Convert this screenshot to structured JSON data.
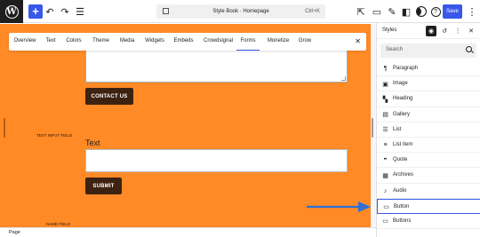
{
  "topbar": {
    "document_title": "Style Book · Homepage",
    "shortcut": "Ctrl+K",
    "save_label": "Save",
    "add_glyph": "+"
  },
  "tabs": [
    "Overview",
    "Text",
    "Colors",
    "Theme",
    "Media",
    "Widgets",
    "Embeds",
    "Crowdsignal",
    "Forms",
    "Monetize",
    "Grow"
  ],
  "active_tab": "Forms",
  "canvas": {
    "background": "#ff8a26",
    "contact_button": "CONTACT US",
    "text_input_side_label": "TEXT INPUT FIELD",
    "text_input_label": "Text",
    "submit_button": "SUBMIT",
    "name_side_label": "NAME FIELD"
  },
  "statusbar": {
    "breadcrumb": "Page"
  },
  "sidebar": {
    "title": "Styles",
    "search_placeholder": "Search",
    "blocks": [
      {
        "label": "Paragraph",
        "icon": "paragraph-icon",
        "glyph": "¶"
      },
      {
        "label": "Image",
        "icon": "image-icon",
        "glyph": "▣"
      },
      {
        "label": "Heading",
        "icon": "heading-icon",
        "glyph": "▚"
      },
      {
        "label": "Gallery",
        "icon": "gallery-icon",
        "glyph": "▤"
      },
      {
        "label": "List",
        "icon": "list-icon",
        "glyph": "☰"
      },
      {
        "label": "List item",
        "icon": "list-item-icon",
        "glyph": "≡"
      },
      {
        "label": "Quote",
        "icon": "quote-icon",
        "glyph": "❞"
      },
      {
        "label": "Archives",
        "icon": "archives-icon",
        "glyph": "▦"
      },
      {
        "label": "Audio",
        "icon": "audio-icon",
        "glyph": "♪"
      },
      {
        "label": "Button",
        "icon": "button-icon",
        "glyph": "▭"
      },
      {
        "label": "Buttons",
        "icon": "buttons-icon",
        "glyph": "▭"
      }
    ],
    "highlighted_block": "Button"
  },
  "colors": {
    "accent": "#3858e9",
    "button_dark": "#3d2212",
    "arrow": "#2f6fd6"
  }
}
